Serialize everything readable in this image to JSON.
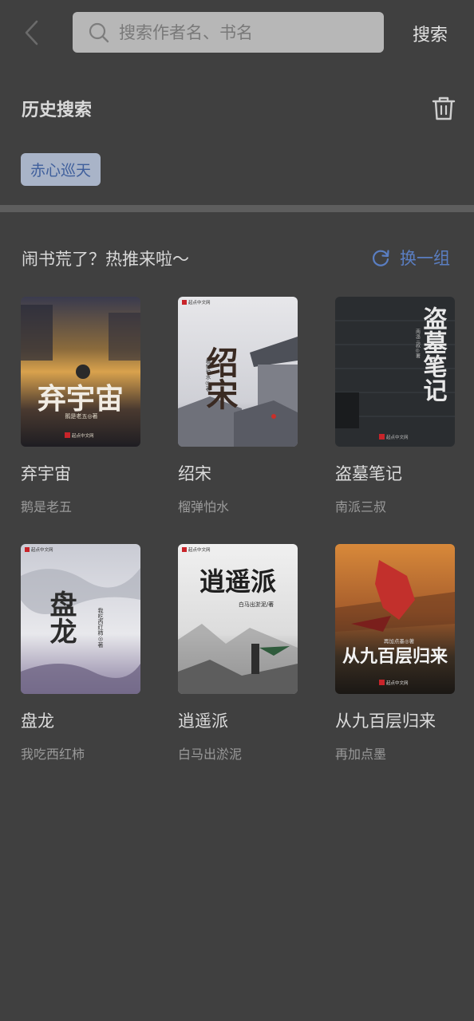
{
  "header": {
    "back_icon": "chevron-left-icon",
    "search_icon": "search-icon",
    "search_placeholder": "搜索作者名、书名",
    "search_button": "搜索"
  },
  "history": {
    "title": "历史搜索",
    "clear_icon": "trash-icon",
    "items": [
      "赤心巡天"
    ]
  },
  "recommend": {
    "title": "闹书荒了？热推来啦～",
    "refresh_icon": "refresh-icon",
    "refresh_label": "换一组",
    "books": [
      {
        "title": "弃宇宙",
        "author": "鹅是老五",
        "cover_text": "弃宇宙",
        "cover_byline": "鹅是老五◎著",
        "cover_publisher": "起点中文网"
      },
      {
        "title": "绍宋",
        "author": "榴弹怕水",
        "cover_text": "绍宋",
        "cover_byline": "榴弹怕水◎著",
        "cover_publisher": "起点中文网"
      },
      {
        "title": "盗墓笔记",
        "author": "南派三叔",
        "cover_text": "盗墓笔记",
        "cover_byline": "南派三叔◎著",
        "cover_publisher": "起点中文网"
      },
      {
        "title": "盘龙",
        "author": "我吃西红柿",
        "cover_text": "盘龙",
        "cover_byline": "我吃西红柿◎著",
        "cover_publisher": "起点中文网"
      },
      {
        "title": "逍遥派",
        "author": "白马出淤泥",
        "cover_text": "逍遥派",
        "cover_byline": "白马出淤泥/著",
        "cover_publisher": "起点中文网"
      },
      {
        "title": "从九百层归来",
        "author": "再加点墨",
        "cover_text": "从九百层归来",
        "cover_byline": "再加点墨◎著",
        "cover_publisher": "起点中文网"
      }
    ]
  },
  "colors": {
    "background": "#404040",
    "accent_link": "#5a7ec2",
    "chip_bg": "#a9b4c8",
    "chip_text": "#3f5f9c"
  }
}
